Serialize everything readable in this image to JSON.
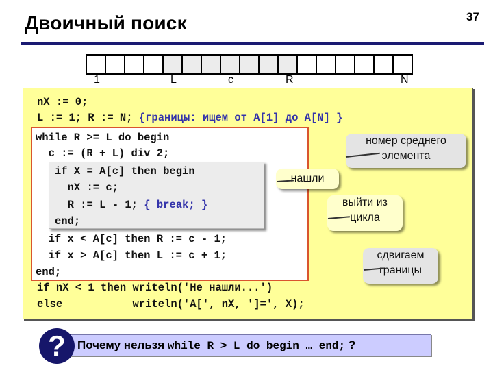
{
  "header": {
    "title": "Двоичный поиск",
    "page_number": "37"
  },
  "array_diagram": {
    "cell_count": 17,
    "shaded_range": [
      5,
      11
    ],
    "labels": [
      {
        "text": "1",
        "cell": 1
      },
      {
        "text": "L",
        "cell": 5
      },
      {
        "text": "c",
        "cell": 8
      },
      {
        "text": "R",
        "cell": 11
      },
      {
        "text": "N",
        "cell": 17
      }
    ]
  },
  "code": {
    "line1": "nX := 0;",
    "line2_code": "L := 1; R := N; ",
    "line2_comment": "{границы: ищем от A[1] до A[N] }",
    "loop_line1": "while R >= L do begin",
    "loop_line2": "  c := (R + L) div 2;",
    "if_line1": "if X = A[c] then begin",
    "if_line2": "  nX := c;",
    "if_line3_code": "  R := L - 1; ",
    "if_line3_comment": "{ break; }",
    "if_line4": "end;",
    "loop_line3": "  if x < A[c] then R := c - 1;",
    "loop_line4": "  if x > A[c] then L := c + 1;",
    "loop_end": "end;",
    "after_line1": "if nX < 1 then writeln('Не нашли...')",
    "after_line2": "else           writeln('A[', nX, ']=', X);"
  },
  "callouts": {
    "middle_element": "номер среднего\nэлемента",
    "found": "нашли",
    "exit_loop": "выйти из\nцикла",
    "shift_bounds": "сдвигаем\nграницы"
  },
  "question": {
    "icon": "question-mark-icon",
    "prefix": "Почему нельзя ",
    "code": "while R > L do begin … end;",
    "suffix": " ?"
  },
  "colors": {
    "title_rule": "#1a1a72",
    "main_background": "#ffff99",
    "loop_border": "#d9552e",
    "comment": "#3333aa",
    "question_bar": "#ccccff",
    "question_icon": "#16166a"
  }
}
